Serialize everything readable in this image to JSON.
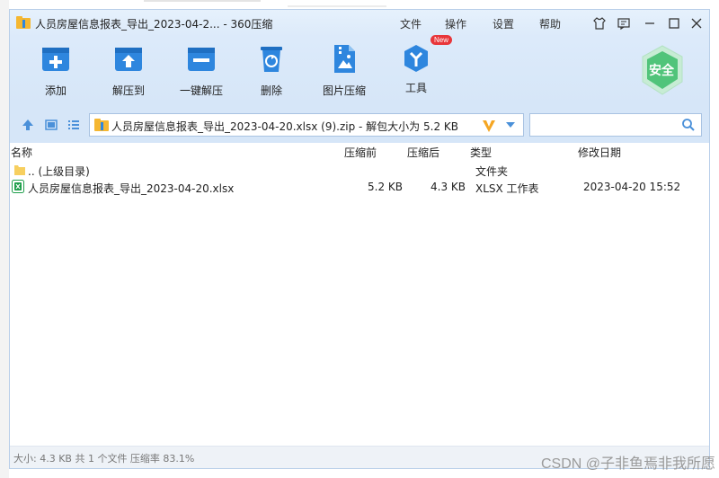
{
  "window": {
    "title": "人员房屋信息报表_导出_2023-04-2... - 360压缩"
  },
  "menu": [
    "文件",
    "操作",
    "设置",
    "帮助"
  ],
  "toolbar": [
    {
      "label": "添加",
      "icon": "add-icon"
    },
    {
      "label": "解压到",
      "icon": "extract-to-icon"
    },
    {
      "label": "一键解压",
      "icon": "one-click-extract-icon"
    },
    {
      "label": "删除",
      "icon": "delete-icon"
    },
    {
      "label": "图片压缩",
      "icon": "image-compress-icon"
    },
    {
      "label": "工具",
      "icon": "tools-icon",
      "badge": "New"
    }
  ],
  "safe_badge": "安全",
  "address": {
    "path": "人员房屋信息报表_导出_2023-04-20.xlsx (9).zip - 解包大小为 5.2 KB"
  },
  "columns": [
    "名称",
    "压缩前",
    "压缩后",
    "类型",
    "修改日期"
  ],
  "files": [
    {
      "name": ".. (上级目录)",
      "original": "",
      "compressed": "",
      "type": "文件夹",
      "date": ""
    },
    {
      "name": "人员房屋信息报表_导出_2023-04-20.xlsx",
      "original": "5.2 KB",
      "compressed": "4.3 KB",
      "type": "XLSX 工作表",
      "date": "2023-04-20 15:52"
    }
  ],
  "status": "大小: 4.3 KB 共 1 个文件 压缩率 83.1%",
  "watermark": "CSDN @子非鱼焉非我所愿",
  "colors": {
    "accent": "#2e86de",
    "titlebar": "#dceafa",
    "new_badge": "#e8363a"
  }
}
